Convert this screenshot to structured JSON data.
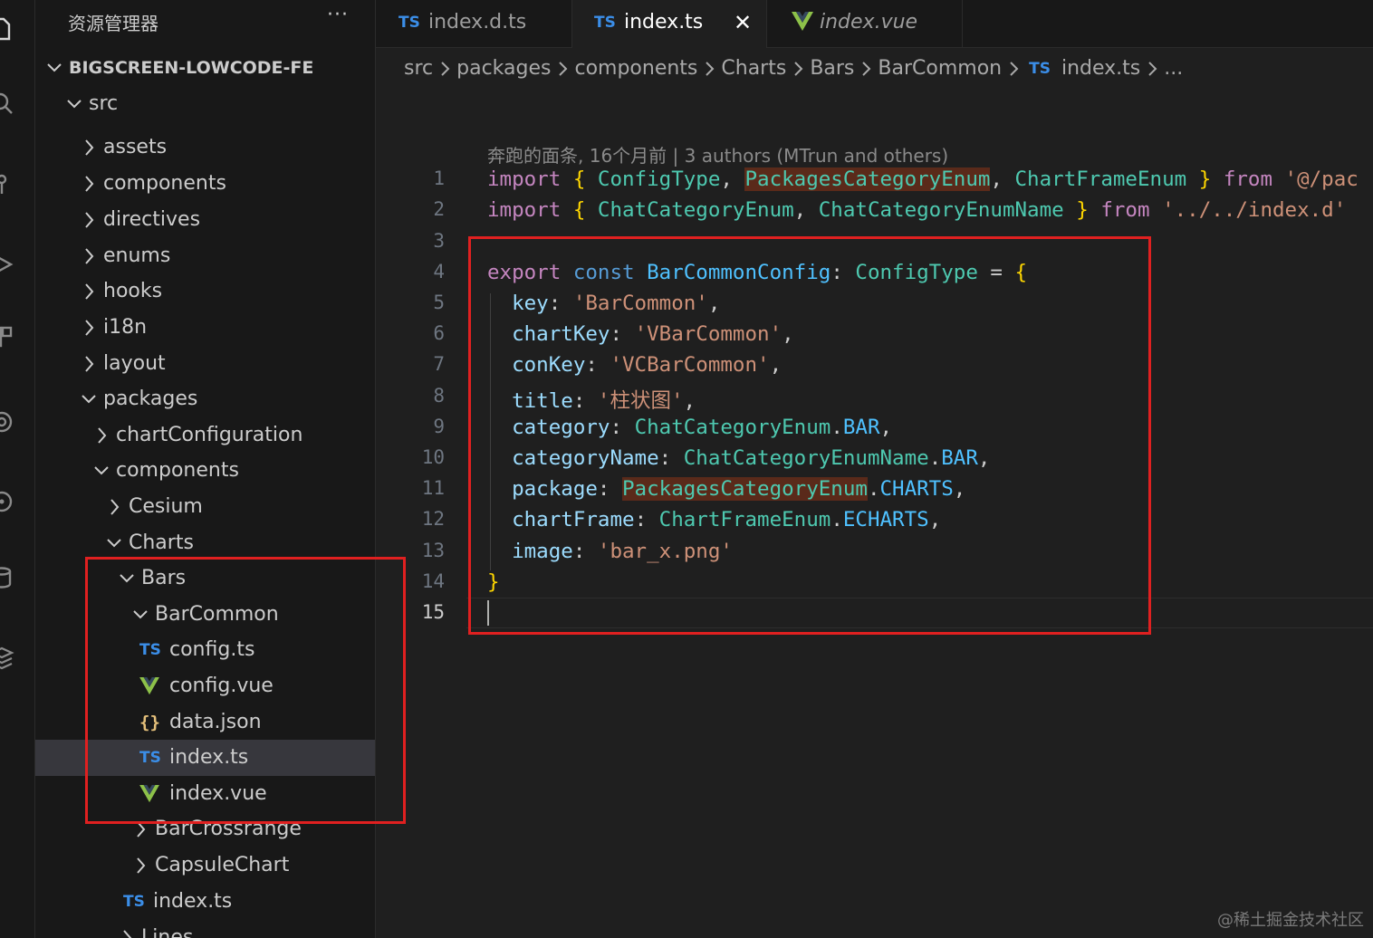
{
  "sidebar": {
    "title": "资源管理器",
    "more": "···",
    "tree": [
      {
        "label": "BIGSCREEN-LOWCODE-FE",
        "kind": "root"
      },
      {
        "label": "src",
        "kind": "folder-open"
      },
      {
        "label": "assets",
        "kind": "folder"
      },
      {
        "label": "components",
        "kind": "folder"
      },
      {
        "label": "directives",
        "kind": "folder"
      },
      {
        "label": "enums",
        "kind": "folder"
      },
      {
        "label": "hooks",
        "kind": "folder"
      },
      {
        "label": "i18n",
        "kind": "folder"
      },
      {
        "label": "layout",
        "kind": "folder"
      },
      {
        "label": "packages",
        "kind": "folder-open"
      },
      {
        "label": "chartConfiguration",
        "kind": "folder"
      },
      {
        "label": "components",
        "kind": "folder-open"
      },
      {
        "label": "Cesium",
        "kind": "folder"
      },
      {
        "label": "Charts",
        "kind": "folder-open"
      },
      {
        "label": "Bars",
        "kind": "folder-open"
      },
      {
        "label": "BarCommon",
        "kind": "folder-open"
      },
      {
        "label": "config.ts",
        "kind": "ts",
        "badge": "TS"
      },
      {
        "label": "config.vue",
        "kind": "vue"
      },
      {
        "label": "data.json",
        "kind": "json",
        "badge": "{}"
      },
      {
        "label": "index.ts",
        "kind": "ts",
        "badge": "TS",
        "selected": true
      },
      {
        "label": "index.vue",
        "kind": "vue"
      },
      {
        "label": "BarCrossrange",
        "kind": "folder"
      },
      {
        "label": "CapsuleChart",
        "kind": "folder"
      },
      {
        "label": "index.ts",
        "kind": "ts",
        "badge": "TS"
      },
      {
        "label": "Lines",
        "kind": "folder"
      }
    ]
  },
  "tabs": [
    {
      "label": "index.d.ts",
      "badge": "TS"
    },
    {
      "label": "index.ts",
      "badge": "TS",
      "close": "✕"
    },
    {
      "label": "index.vue"
    }
  ],
  "breadcrumb": [
    "src",
    "packages",
    "components",
    "Charts",
    "Bars",
    "BarCommon",
    "index.ts",
    "..."
  ],
  "breadcrumb_badge": "TS",
  "editor": {
    "blame": "奔跑的面条, 16个月前 | 3 authors (MTrun and others)",
    "line_numbers": [
      "1",
      "2",
      "3",
      "4",
      "5",
      "6",
      "7",
      "8",
      "9",
      "10",
      "11",
      "12",
      "13",
      "14",
      "15"
    ]
  },
  "code_tokens": {
    "import": "import",
    "lbrace": "{",
    "rbrace": "}",
    "from": "from",
    "comma": ",",
    "comma_sp": ", ",
    "ConfigType": "ConfigType",
    "PackagesCategoryEnum": "PackagesCategoryEnum",
    "ChartFrameEnum": "ChartFrameEnum",
    "path1": "'@/pac",
    "ChatCategoryEnum": "ChatCategoryEnum",
    "ChatCategoryEnumName": "ChatCategoryEnumName",
    "path2": "'../../index.d'",
    "export": "export",
    "const": "const",
    "BarCommonConfig": "BarCommonConfig",
    "colon": ":",
    "eq": "=",
    "key": "key",
    "v_key": "'BarCommon'",
    "chartKey": "chartKey",
    "v_chartKey": "'VBarCommon'",
    "conKey": "conKey",
    "v_conKey": "'VCBarCommon'",
    "title": "title",
    "v_title": "'柱状图'",
    "category": "category",
    "categoryName": "categoryName",
    "dot": ".",
    "BAR": "BAR",
    "package": "package",
    "CHARTS": "CHARTS",
    "chartFrame": "chartFrame",
    "ECHARTS": "ECHARTS",
    "image": "image",
    "v_image": "'bar_x.png'"
  },
  "watermark": "@稀土掘金技术社区",
  "colors": {
    "accent_box": "#e02020",
    "ts_badge": "#3b8ee8",
    "vue_logo": "#8dc149",
    "selected_row": "#37373d"
  }
}
